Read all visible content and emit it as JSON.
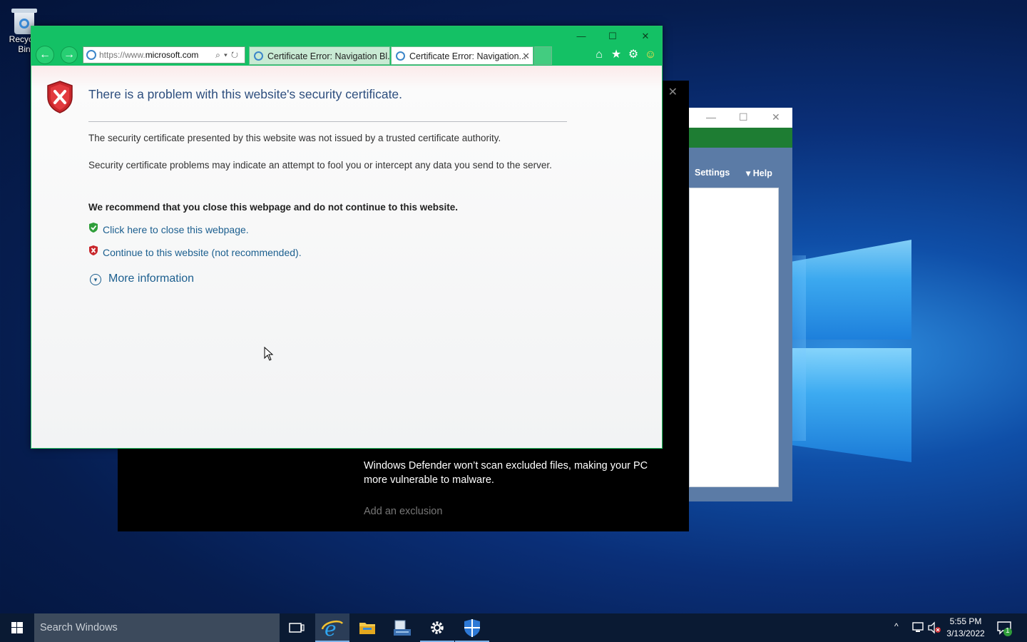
{
  "desktop": {
    "recycle_bin_label": "Recycle Bin",
    "logo_color": "#3fb0f5"
  },
  "defender_window": {
    "message": "Windows Defender won’t scan excluded files, making your PC more vulnerable to malware.",
    "add_exclusion_label": "Add an exclusion",
    "close_glyph": "✕"
  },
  "settings_window": {
    "menu_settings": "Settings",
    "menu_help": "Help",
    "minimize_glyph": "—",
    "maximize_glyph": "☐",
    "close_glyph": "✕",
    "help_arrow": "▾",
    "accent": "#1e7d33"
  },
  "browser": {
    "accent": "#14c165",
    "caption": {
      "minimize": "—",
      "maximize": "☐",
      "close": "✕"
    },
    "address": {
      "prefix": "https://www.",
      "domain": "microsoft.com",
      "tools": "⌕▾↻"
    },
    "back_glyph": "←",
    "forward_glyph": "→",
    "tabs": [
      {
        "label": "Certificate Error: Navigation Bl..."
      },
      {
        "label": "Certificate Error: Navigation...",
        "close": "✕"
      }
    ],
    "toolbar": {
      "home": "⌂",
      "favorites": "★",
      "tools": "⚙",
      "feedback": "☺"
    }
  },
  "page": {
    "heading": "There is a problem with this website's security certificate.",
    "para1": "The security certificate presented by this website was not issued by a trusted certificate authority.",
    "para2": "Security certificate problems may indicate an attempt to fool you or intercept any data you send to the server.",
    "recommendation": "We recommend that you close this webpage and do not continue to this website.",
    "close_link": "Click here to close this webpage.",
    "continue_link": "Continue to this website (not recommended).",
    "more_info": "More information",
    "more_info_glyph": "▾",
    "error_color": "#c8262b",
    "ok_color": "#2f9e3a"
  },
  "taskbar": {
    "search_placeholder": "Search Windows",
    "time": "5:55 PM",
    "date": "3/13/2022",
    "notification_count": "1",
    "tray_chevron": "^"
  }
}
